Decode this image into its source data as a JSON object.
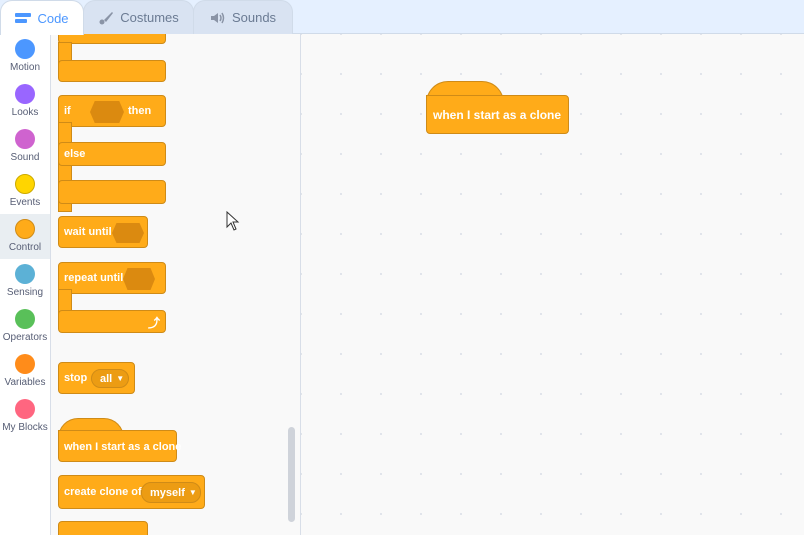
{
  "tabs": [
    {
      "label": "Code",
      "icon": "code-icon",
      "active": true
    },
    {
      "label": "Costumes",
      "icon": "brush-icon",
      "active": false
    },
    {
      "label": "Sounds",
      "icon": "speaker-icon",
      "active": false
    }
  ],
  "categories": [
    {
      "label": "Motion",
      "color": "#4c97ff"
    },
    {
      "label": "Looks",
      "color": "#9966ff"
    },
    {
      "label": "Sound",
      "color": "#cf63cf"
    },
    {
      "label": "Events",
      "color": "#ffd500"
    },
    {
      "label": "Control",
      "color": "#ffab19",
      "selected": true
    },
    {
      "label": "Sensing",
      "color": "#5cb1d6"
    },
    {
      "label": "Operators",
      "color": "#59c059"
    },
    {
      "label": "Variables",
      "color": "#ff8c1a"
    },
    {
      "label": "My Blocks",
      "color": "#ff6680"
    }
  ],
  "palette": {
    "if_label": "if",
    "then_label": "then",
    "else_label": "else",
    "wait_until_label": "wait until",
    "repeat_until_label": "repeat until",
    "stop_label": "stop",
    "stop_option": "all",
    "clone_hat_label": "when I start as a clone",
    "create_clone_label": "create clone of",
    "create_clone_option": "myself"
  },
  "workspace": {
    "hat_block_label": "when I start as a clone"
  }
}
